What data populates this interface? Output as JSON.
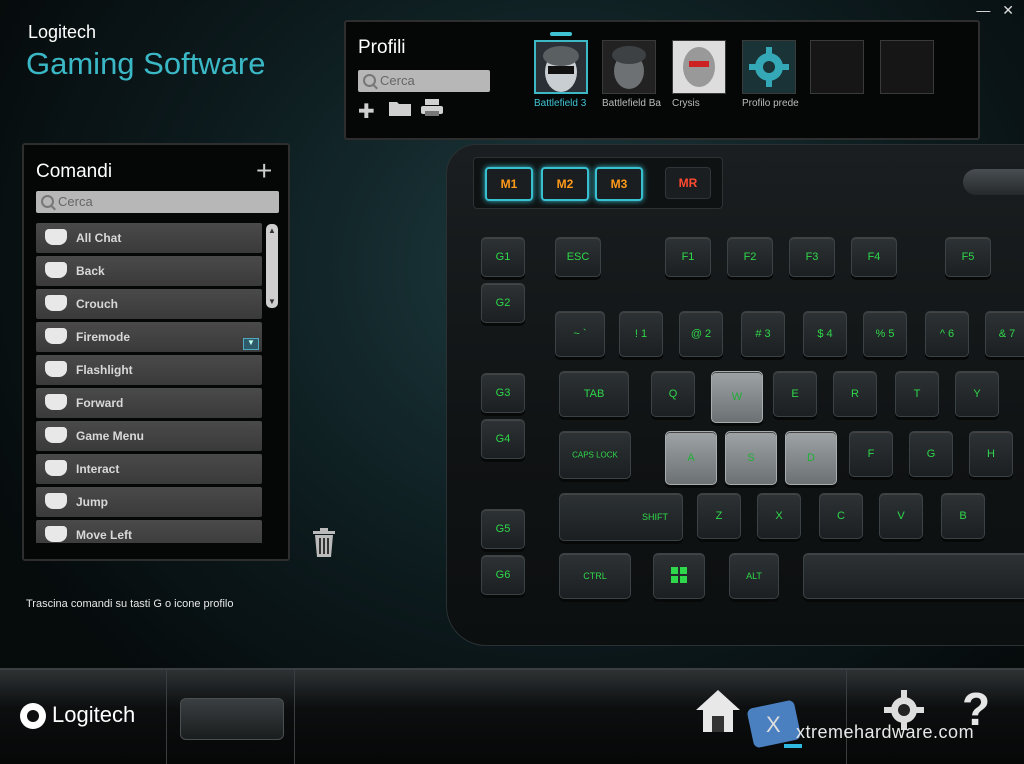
{
  "window": {
    "minimize": "—",
    "close": "✕"
  },
  "brand": {
    "top": "Logitech",
    "main": "Gaming Software"
  },
  "profiles": {
    "title": "Profili",
    "search_placeholder": "Cerca",
    "items": [
      {
        "label": "Battlefield 3",
        "active": true
      },
      {
        "label": "Battlefield Ba",
        "active": false
      },
      {
        "label": "Crysis",
        "active": false
      },
      {
        "label": "Profilo prede",
        "active": false
      },
      {
        "label": "",
        "active": false
      },
      {
        "label": "",
        "active": false
      }
    ]
  },
  "commands": {
    "title": "Comandi",
    "add": "+",
    "search_placeholder": "Cerca",
    "items": [
      {
        "label": "All Chat"
      },
      {
        "label": "Back"
      },
      {
        "label": "Crouch"
      },
      {
        "label": "Firemode"
      },
      {
        "label": "Flashlight"
      },
      {
        "label": "Forward"
      },
      {
        "label": "Game Menu"
      },
      {
        "label": "Interact"
      },
      {
        "label": "Jump"
      },
      {
        "label": "Move Left"
      }
    ]
  },
  "hint": "Trascina comandi su tasti G o icone profilo",
  "keyboard": {
    "mkeys": [
      "M1",
      "M2",
      "M3",
      "MR"
    ],
    "gkeys": [
      "G1",
      "G2",
      "G3",
      "G4",
      "G5",
      "G6"
    ],
    "row_f": [
      "ESC",
      "F1",
      "F2",
      "F3",
      "F4",
      "F5"
    ],
    "row_num": [
      "~ `",
      "! 1",
      "@ 2",
      "# 3",
      "$ 4",
      "% 5",
      "^ 6",
      "& 7"
    ],
    "row_tab": [
      "TAB",
      "Q",
      "W",
      "E",
      "R",
      "T",
      "Y"
    ],
    "row_caps": [
      "CAPS LOCK",
      "A",
      "S",
      "D",
      "F",
      "G",
      "H"
    ],
    "row_shift": [
      "SHIFT",
      "Z",
      "X",
      "C",
      "V",
      "B"
    ],
    "row_ctrl": [
      "CTRL",
      "",
      "ALT"
    ]
  },
  "bottom": {
    "logo": "Logitech",
    "watermark": "xtremehardware.com"
  }
}
